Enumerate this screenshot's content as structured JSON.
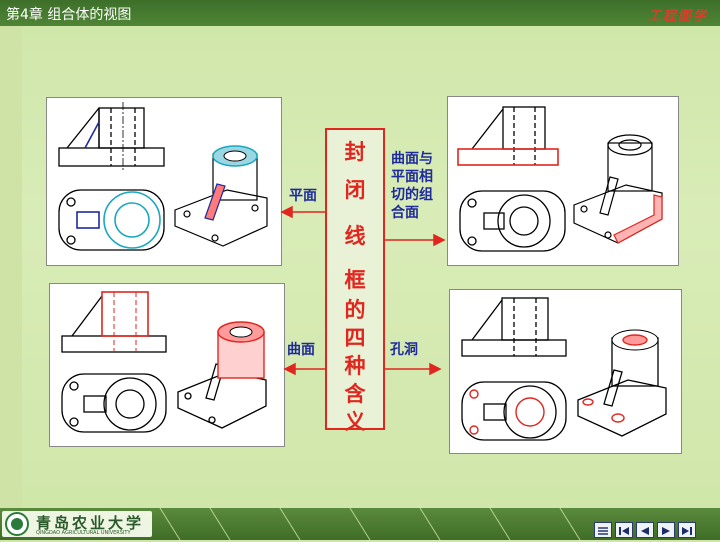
{
  "header": {
    "chapter": "第4章  组合体的视图",
    "brand": "工程图学"
  },
  "center": {
    "chars": [
      "封",
      "闭",
      "线",
      "框",
      "的",
      "四",
      "种",
      "含",
      "义"
    ]
  },
  "labels": {
    "plane": "平面",
    "curved_tangent": [
      "曲面与",
      "平面相",
      "切的组",
      "合面"
    ],
    "curved": "曲面",
    "hole": "孔洞"
  },
  "footer": {
    "university": "青岛农业大学",
    "university_en": "QINGDAO AGRICULTURAL UNIVERSITY"
  },
  "nav": {
    "buttons": [
      "menu",
      "first",
      "prev",
      "next",
      "last"
    ]
  },
  "colors": {
    "accent": "#e0261f",
    "blue": "#1e2b9c",
    "cyan": "#18a8c0"
  }
}
